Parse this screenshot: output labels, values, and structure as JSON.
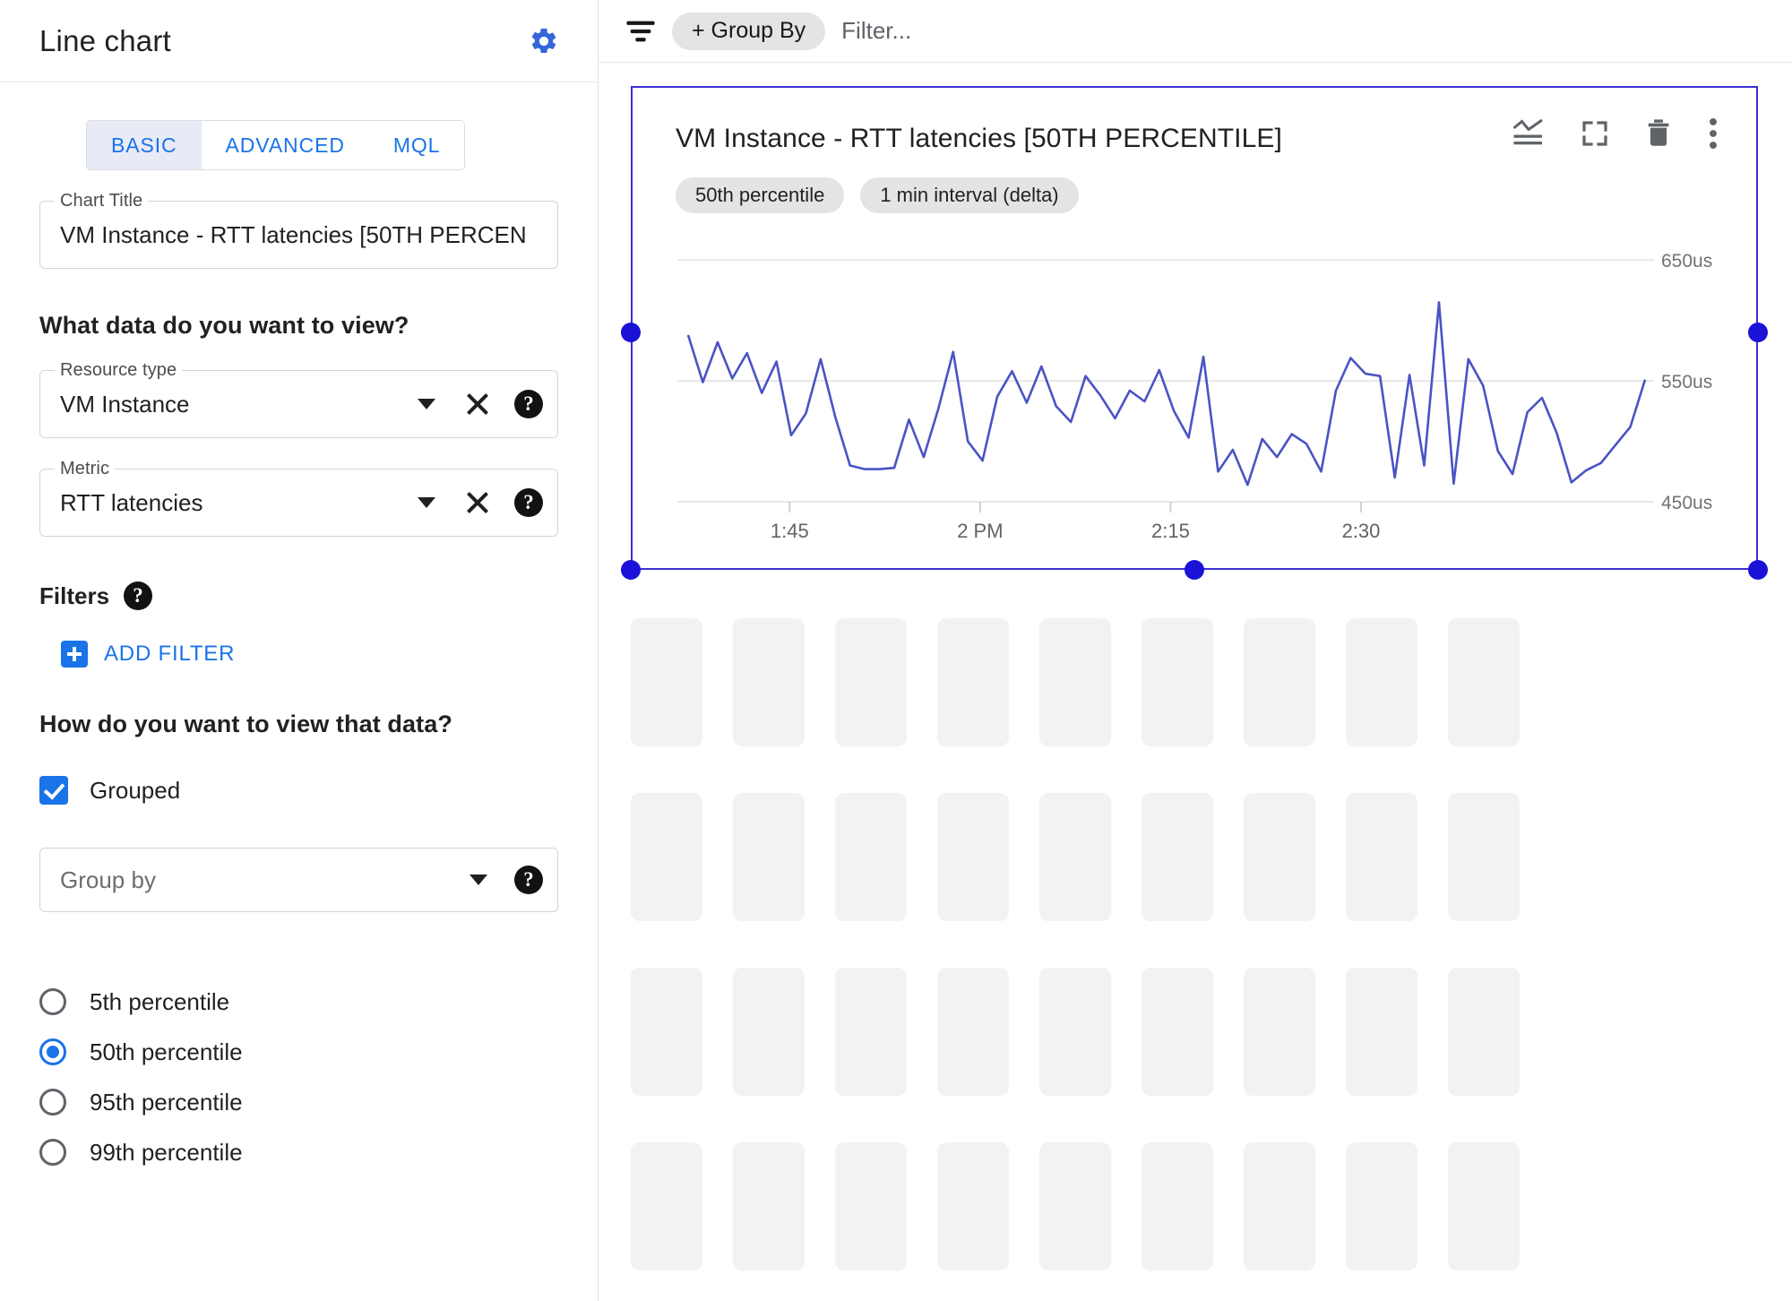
{
  "sidebar": {
    "title": "Line chart",
    "gear_icon": "gear-icon",
    "tabs": [
      {
        "label": "BASIC",
        "active": true
      },
      {
        "label": "ADVANCED",
        "active": false
      },
      {
        "label": "MQL",
        "active": false
      }
    ],
    "chart_title_field": {
      "legend": "Chart Title",
      "value": "VM Instance - RTT latencies [50TH PERCEN"
    },
    "data_question": "What data do you want to view?",
    "resource_type_field": {
      "legend": "Resource type",
      "value": "VM Instance"
    },
    "metric_field": {
      "legend": "Metric",
      "value": "RTT latencies"
    },
    "filters_label": "Filters",
    "add_filter_label": "ADD FILTER",
    "view_question": "How do you want to view that data?",
    "grouped_label": "Grouped",
    "grouped_checked": true,
    "group_by_field": {
      "placeholder": "Group by"
    },
    "percentile_options": [
      {
        "label": "5th percentile",
        "selected": false
      },
      {
        "label": "50th percentile",
        "selected": true
      },
      {
        "label": "95th percentile",
        "selected": false
      },
      {
        "label": "99th percentile",
        "selected": false
      }
    ]
  },
  "topbar": {
    "filter_icon": "filter-list-icon",
    "group_by_chip": "+ Group By",
    "filter_placeholder": "Filter..."
  },
  "card": {
    "title": "VM Instance - RTT latencies [50TH PERCENTILE]",
    "chips": [
      "50th percentile",
      "1 min interval (delta)"
    ],
    "actions": [
      {
        "name": "chart-legend-icon"
      },
      {
        "name": "fullscreen-icon"
      },
      {
        "name": "delete-icon"
      },
      {
        "name": "more-options-icon"
      }
    ],
    "selected": true
  },
  "colors": {
    "accent": "#1a73e8",
    "selection": "#3b2fd4",
    "handle": "#1a12d6",
    "line": "#4a53c4",
    "grid": "#e8e8e8",
    "skeleton": "#f2f2f2",
    "chip_bg": "#e4e4e4"
  },
  "chart_data": {
    "type": "line",
    "title": "VM Instance - RTT latencies [50TH PERCENTILE]",
    "xlabel": "",
    "ylabel": "",
    "unit": "us",
    "grid": true,
    "legend": "none",
    "ylim": [
      450,
      665
    ],
    "yticks": [
      450,
      550,
      650
    ],
    "ytick_labels": [
      "450us",
      "550us",
      "650us"
    ],
    "xticks": [
      "1:45",
      "2 PM",
      "2:15",
      "2:30"
    ],
    "xtick_positions": [
      0.115,
      0.31,
      0.505,
      0.7
    ],
    "series": [
      {
        "name": "50th percentile",
        "color": "#4a53c4",
        "values": [
          588,
          549,
          582,
          552,
          573,
          540,
          566,
          505,
          523,
          568,
          520,
          480,
          477,
          477,
          478,
          518,
          487,
          527,
          574,
          500,
          484,
          537,
          558,
          532,
          562,
          529,
          516,
          554,
          538,
          519,
          542,
          533,
          559,
          525,
          503,
          570,
          475,
          493,
          464,
          502,
          487,
          506,
          498,
          475,
          542,
          569,
          556,
          554,
          470,
          555,
          480,
          615,
          465,
          568,
          546,
          492,
          473,
          524,
          536,
          507,
          466,
          476,
          482,
          497,
          512,
          551
        ]
      }
    ]
  }
}
